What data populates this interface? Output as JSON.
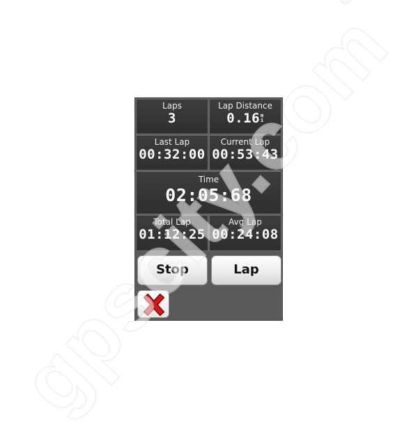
{
  "fields": {
    "laps": {
      "label": "Laps",
      "value": "3"
    },
    "lap_distance": {
      "label": "Lap Distance",
      "value": "0.16",
      "unit": "mi"
    },
    "last_lap": {
      "label": "Last Lap",
      "value": "00:32:00"
    },
    "current_lap": {
      "label": "Current Lap",
      "value": "00:53:43"
    },
    "time": {
      "label": "Time",
      "value": "02:05:68"
    },
    "total_lap": {
      "label": "Total Lap",
      "value": "01:12:25"
    },
    "avg_lap": {
      "label": "Avg Lap",
      "value": "00:24:08"
    }
  },
  "buttons": {
    "stop": "Stop",
    "lap": "Lap",
    "close_icon": "close-icon"
  },
  "watermark": {
    "text": "gpscity.com",
    "mark": "®"
  },
  "colors": {
    "close_x": "#d31a1a",
    "tile_bg": "#333333",
    "device_bg": "#5a5a5a"
  }
}
